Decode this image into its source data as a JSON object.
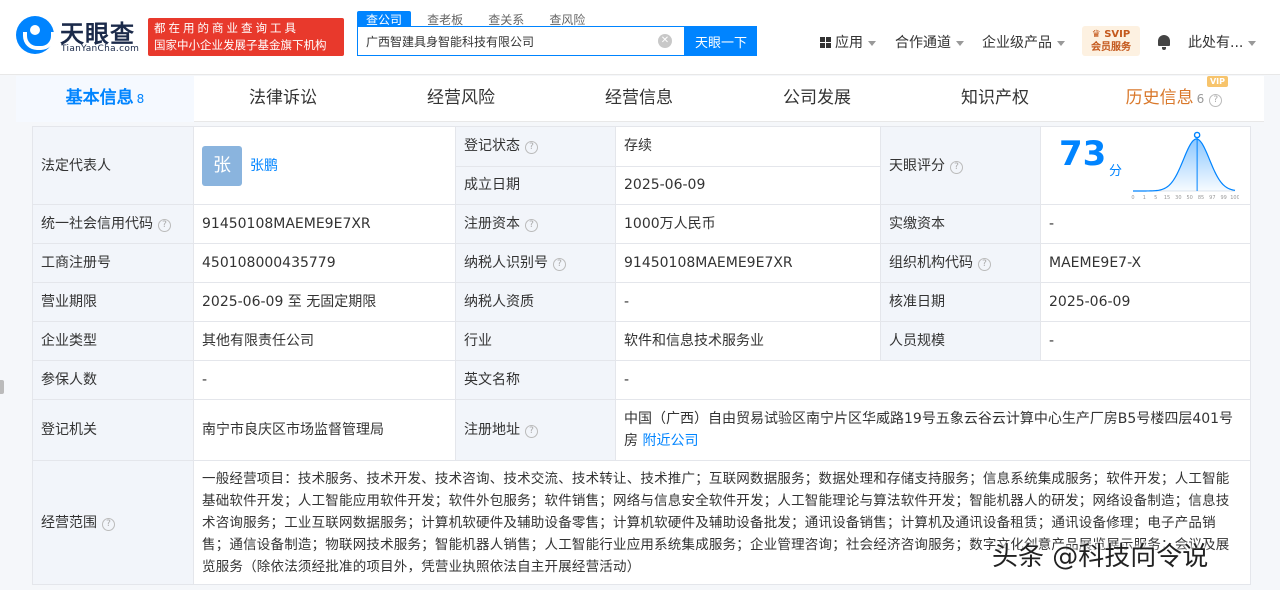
{
  "header": {
    "logo_name": "天眼查",
    "logo_domain": "TianYanCha.com",
    "slogan_line1": "都在用的商业查询工具",
    "slogan_line2": "国家中小企业发展子基金旗下机构",
    "search_tabs": [
      "查公司",
      "查老板",
      "查关系",
      "查风险"
    ],
    "search_value": "广西智建具身智能科技有限公司",
    "search_button": "天眼一下",
    "nav": {
      "apps": "应用",
      "partner": "合作通道",
      "enterprise": "企业级产品",
      "vip_line1": "SVIP",
      "vip_line2": "会员服务",
      "user": "此处有..."
    }
  },
  "tabs": [
    {
      "label": "基本信息",
      "count": "8"
    },
    {
      "label": "法律诉讼"
    },
    {
      "label": "经营风险"
    },
    {
      "label": "经营信息"
    },
    {
      "label": "公司发展"
    },
    {
      "label": "知识产权"
    },
    {
      "label": "历史信息",
      "count": "6",
      "tag": "VIP"
    }
  ],
  "info": {
    "legal_rep_label": "法定代表人",
    "legal_rep_avatar": "张",
    "legal_rep_name": "张鹏",
    "reg_status_label": "登记状态",
    "reg_status": "存续",
    "found_date_label": "成立日期",
    "found_date": "2025-06-09",
    "score_label": "天眼评分",
    "score": "73",
    "score_unit": "分",
    "credit_code_label": "统一社会信用代码",
    "credit_code": "91450108MAEME9E7XR",
    "reg_capital_label": "注册资本",
    "reg_capital": "1000万人民币",
    "paid_capital_label": "实缴资本",
    "paid_capital": "-",
    "biz_reg_no_label": "工商注册号",
    "biz_reg_no": "450108000435779",
    "tax_id_label": "纳税人识别号",
    "tax_id": "91450108MAEME9E7XR",
    "org_code_label": "组织机构代码",
    "org_code": "MAEME9E7-X",
    "term_label": "营业期限",
    "term": "2025-06-09 至 无固定期限",
    "tax_qual_label": "纳税人资质",
    "tax_qual": "-",
    "approve_date_label": "核准日期",
    "approve_date": "2025-06-09",
    "type_label": "企业类型",
    "type": "其他有限责任公司",
    "industry_label": "行业",
    "industry": "软件和信息技术服务业",
    "staff_label": "人员规模",
    "staff": "-",
    "insured_label": "参保人数",
    "insured": "-",
    "en_name_label": "英文名称",
    "en_name": "-",
    "authority_label": "登记机关",
    "authority": "南宁市良庆区市场监督管理局",
    "address_label": "注册地址",
    "address": "中国（广西）自由贸易试验区南宁片区华威路19号五象云谷云计算中心生产厂房B5号楼四层401号房",
    "nearby_link": "附近公司",
    "scope_label": "经营范围",
    "scope": "一般经营项目：技术服务、技术开发、技术咨询、技术交流、技术转让、技术推广；互联网数据服务；数据处理和存储支持服务；信息系统集成服务；软件开发；人工智能基础软件开发；人工智能应用软件开发；软件外包服务；软件销售；网络与信息安全软件开发；人工智能理论与算法软件开发；智能机器人的研发；网络设备制造；信息技术咨询服务；工业互联网数据服务；计算机软硬件及辅助设备零售；计算机软硬件及辅助设备批发；通讯设备销售；计算机及通讯设备租赁；通讯设备修理；电子产品销售；通信设备制造；物联网技术服务；智能机器人销售；人工智能行业应用系统集成服务；企业管理咨询；社会经济咨询服务；数字文化创意产品展览展示服务；会议及展览服务（除依法须经批准的项目外，凭营业执照依法自主开展经营活动）"
  },
  "score_chart": {
    "x_ticks": [
      "0",
      "1",
      "5",
      "15",
      "30",
      "50",
      "85",
      "97",
      "99",
      "100"
    ],
    "marker_value": 73
  },
  "watermark": "头条 @科技向令说",
  "colors": {
    "accent": "#0084ff",
    "status": "#21a03b",
    "history": "#d9782b",
    "slogan_bg": "#e8392c"
  }
}
